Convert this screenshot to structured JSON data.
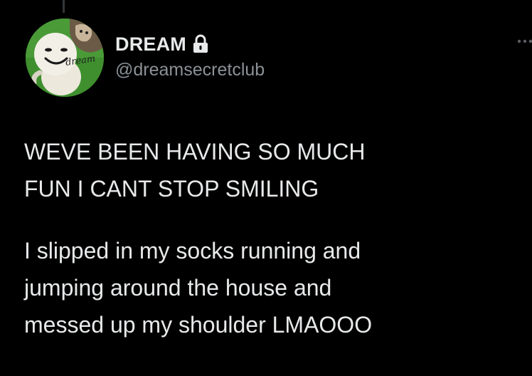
{
  "tweet": {
    "author": {
      "display_name": "DREAM",
      "handle": "@dreamsecretclub",
      "protected_icon": "lock-icon",
      "avatar_text": "dream"
    },
    "paragraphs": [
      "WEVE BEEN HAVING SO MUCH\nFUN I CANT STOP SMILING",
      "I slipped in my socks running and\njumping around the house and\nmessed up my shoulder LMAOOO"
    ],
    "more_icon": "more-dots-icon"
  },
  "colors": {
    "background": "#000000",
    "text_primary": "#e7e9ea",
    "text_secondary": "#8b9196"
  }
}
